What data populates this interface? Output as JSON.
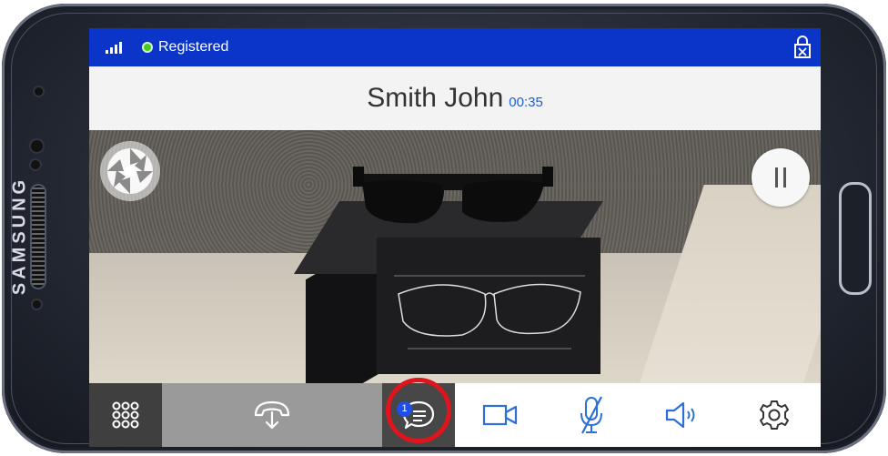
{
  "phone": {
    "brand": "SAMSUNG"
  },
  "status_bar": {
    "registration_text": "Registered",
    "signal_icon": "signal-bars-icon",
    "lock_icon": "lock-icon"
  },
  "call": {
    "caller_name": "Smith John",
    "duration": "00:35"
  },
  "video": {
    "snapshot_icon": "camera-shutter-icon",
    "pause_icon": "pause-icon"
  },
  "toolbar": {
    "items": [
      {
        "icon": "dialpad-icon"
      },
      {
        "icon": "call-transfer-icon"
      },
      {
        "icon": "chat-icon",
        "badge": "1"
      },
      {
        "icon": "video-camera-icon"
      },
      {
        "icon": "microphone-muted-icon"
      },
      {
        "icon": "speaker-icon"
      },
      {
        "icon": "settings-gear-icon"
      }
    ]
  },
  "colors": {
    "status_bar": "#0a35c8",
    "accent_blue": "#1e5fd0",
    "registered_green": "#44cc22",
    "highlight_ring": "#e0141c"
  }
}
